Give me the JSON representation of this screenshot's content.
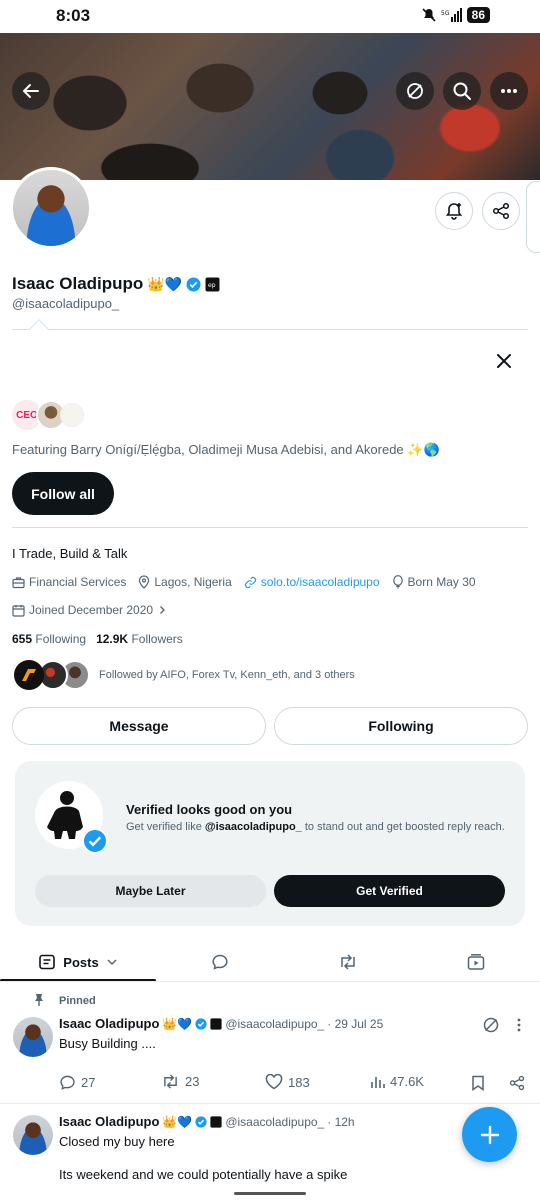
{
  "status_bar": {
    "time": "8:03",
    "battery": "86"
  },
  "profile": {
    "name": "Isaac Oladipupo",
    "name_emoji": "👑💙",
    "handle": "@isaacoladipupo_",
    "bio": "I Trade, Build & Talk",
    "category": "Financial Services",
    "location": "Lagos, Nigeria",
    "website": "solo.to/isaacoladipupo",
    "born": "Born May 30",
    "joined": "Joined December 2020",
    "following_count": "655",
    "following_label": "Following",
    "followers_count": "12.9K",
    "followers_label": "Followers",
    "followed_by": "Followed by AIFO, Forex Tv, Kenn_eth, and 3 others"
  },
  "suggestions": {
    "featuring": "Featuring Barry Onígí/Ẹlẹ́gba, Oladimeji Musa Adebisi, and Akorede ✨🌎",
    "follow_all": "Follow all",
    "ceo_badge": "CEO"
  },
  "buttons": {
    "message": "Message",
    "following": "Following"
  },
  "verified_card": {
    "title": "Verified looks good on you",
    "desc_prefix": "Get verified like ",
    "desc_handle": "@isaacoladipupo_",
    "desc_suffix": " to stand out and get boosted reply reach.",
    "maybe_later": "Maybe Later",
    "get_verified": "Get Verified"
  },
  "tabs": {
    "posts": "Posts"
  },
  "tweets": [
    {
      "pinned_label": "Pinned",
      "name": "Isaac Oladipupo",
      "name_emoji": "👑💙",
      "handle": "@isaacoladipupo_",
      "time": "· 29 Jul 25",
      "text": "Busy Building ....",
      "replies": "27",
      "retweets": "23",
      "likes": "183",
      "views": "47.6K"
    },
    {
      "name": "Isaac Oladipupo",
      "name_emoji": "👑💙",
      "handle": "@isaacoladipupo_",
      "time": "· 12h",
      "text_line1": "Closed my buy here",
      "text_line2": "Its weekend and we could potentially have a spike"
    }
  ],
  "colors": {
    "accent": "#1d9bf0",
    "text": "#0f1419",
    "muted": "#536471"
  }
}
